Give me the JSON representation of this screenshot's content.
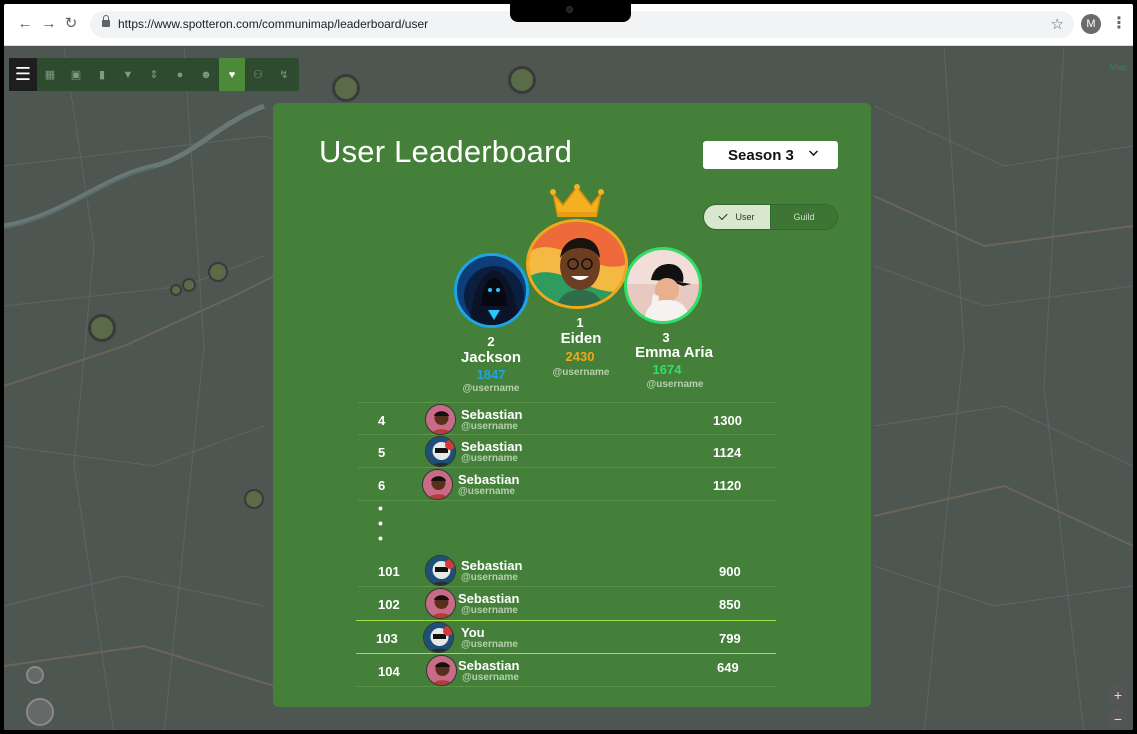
{
  "browser": {
    "url": "https://www.spotteron.com/communimap/leaderboard/user",
    "profile_initial": "M",
    "back_icon": "arrow-left",
    "forward_icon": "arrow-right",
    "reload_icon": "reload",
    "star_icon": "bookmark-star"
  },
  "map": {
    "corner_label": "Map",
    "toolbar_icons": [
      "menu-icon",
      "grid-icon",
      "book-icon",
      "chart-icon",
      "filter-icon",
      "route-icon",
      "info-icon",
      "person-icon",
      "trophy-icon",
      "people-icon",
      "bolt-icon"
    ],
    "zoom_in": "+",
    "zoom_out": "−"
  },
  "leaderboard": {
    "title": "User Leaderboard",
    "season": "Season 3",
    "toggle": {
      "user": "User",
      "guild": "Guild",
      "selected": "User"
    },
    "podium": [
      {
        "rank": "2",
        "name": "Jackson",
        "score": "1847",
        "username": "@username",
        "score_color": "#1ea3e6"
      },
      {
        "rank": "1",
        "name": "Eiden",
        "score": "2430",
        "username": "@username",
        "score_color": "#f2a819"
      },
      {
        "rank": "3",
        "name": "Emma Aria",
        "score": "1674",
        "username": "@username",
        "score_color": "#2ee06a"
      }
    ],
    "rows_top": [
      {
        "rank": "4",
        "name": "Sebastian",
        "username": "@username",
        "score": "1300"
      },
      {
        "rank": "5",
        "name": "Sebastian",
        "username": "@username",
        "score": "1124"
      },
      {
        "rank": "6",
        "name": "Sebastian",
        "username": "@username",
        "score": "1120"
      }
    ],
    "ellipsis": "•\n•\n•",
    "rows_bottom": [
      {
        "rank": "101",
        "name": "Sebastian",
        "username": "@username",
        "score": "900"
      },
      {
        "rank": "102",
        "name": "Sebastian",
        "username": "@username",
        "score": "850"
      },
      {
        "rank": "103",
        "name": "You",
        "username": "@username",
        "score": "799"
      },
      {
        "rank": "104",
        "name": "Sebastian",
        "username": "@username",
        "score": "649"
      }
    ]
  },
  "colors": {
    "panel": "#44803a",
    "highlight_line": "#9ee04a",
    "map_bg": "#4f5754"
  }
}
